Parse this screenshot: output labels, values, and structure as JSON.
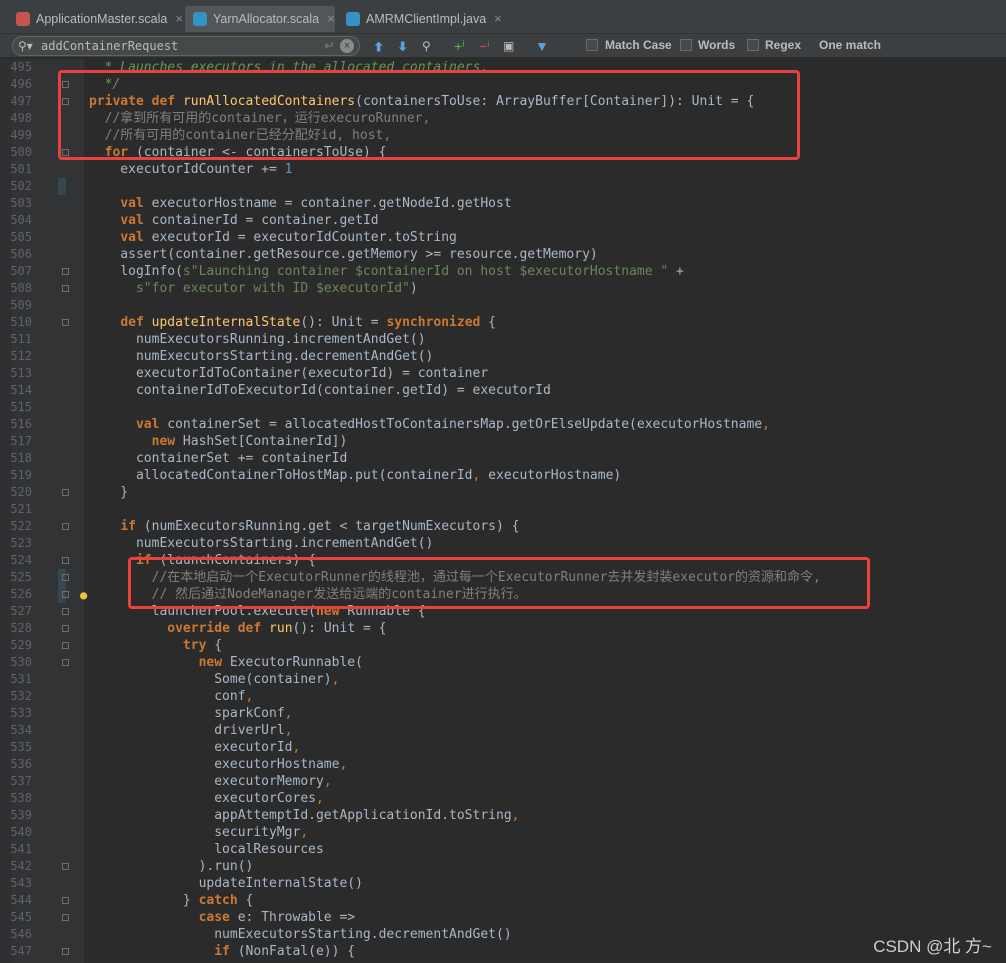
{
  "tabs": [
    {
      "label": "ApplicationMaster.scala",
      "icon": "scala-file-icon",
      "color": "#c75450",
      "active": false
    },
    {
      "label": "YarnAllocator.scala",
      "icon": "scala-class-icon",
      "color": "#3592c4",
      "active": true
    },
    {
      "label": "AMRMClientImpl.java",
      "icon": "java-class-icon",
      "color": "#3592c4",
      "active": false
    }
  ],
  "search": {
    "query": "addContainerRequest",
    "match_case": "Match Case",
    "words": "Words",
    "regex": "Regex",
    "result": "One match"
  },
  "code_lines": [
    {
      "n": "495",
      "t": "  * Launches executors in the allocated containers."
    },
    {
      "n": "496",
      "t": "  */"
    },
    {
      "n": "497",
      "t": "private def runAllocatedContainers(containersToUse: ArrayBuffer[Container]): Unit = {"
    },
    {
      "n": "498",
      "t": "  //拿到所有可用的container，运行execuroRunner,"
    },
    {
      "n": "499",
      "t": "  //所有可用的container已经分配好id, host,"
    },
    {
      "n": "500",
      "t": "  for (container <- containersToUse) {"
    },
    {
      "n": "501",
      "t": "    executorIdCounter += 1"
    },
    {
      "n": "502",
      "t": ""
    },
    {
      "n": "503",
      "t": "    val executorHostname = container.getNodeId.getHost"
    },
    {
      "n": "504",
      "t": "    val containerId = container.getId"
    },
    {
      "n": "505",
      "t": "    val executorId = executorIdCounter.toString"
    },
    {
      "n": "506",
      "t": "    assert(container.getResource.getMemory >= resource.getMemory)"
    },
    {
      "n": "507",
      "t": "    logInfo(s\"Launching container $containerId on host $executorHostname \" +"
    },
    {
      "n": "508",
      "t": "      s\"for executor with ID $executorId\")"
    },
    {
      "n": "509",
      "t": ""
    },
    {
      "n": "510",
      "t": "    def updateInternalState(): Unit = synchronized {"
    },
    {
      "n": "511",
      "t": "      numExecutorsRunning.incrementAndGet()"
    },
    {
      "n": "512",
      "t": "      numExecutorsStarting.decrementAndGet()"
    },
    {
      "n": "513",
      "t": "      executorIdToContainer(executorId) = container"
    },
    {
      "n": "514",
      "t": "      containerIdToExecutorId(container.getId) = executorId"
    },
    {
      "n": "515",
      "t": ""
    },
    {
      "n": "516",
      "t": "      val containerSet = allocatedHostToContainersMap.getOrElseUpdate(executorHostname,"
    },
    {
      "n": "517",
      "t": "        new HashSet[ContainerId])"
    },
    {
      "n": "518",
      "t": "      containerSet += containerId"
    },
    {
      "n": "519",
      "t": "      allocatedContainerToHostMap.put(containerId, executorHostname)"
    },
    {
      "n": "520",
      "t": "    }"
    },
    {
      "n": "521",
      "t": ""
    },
    {
      "n": "522",
      "t": "    if (numExecutorsRunning.get < targetNumExecutors) {"
    },
    {
      "n": "523",
      "t": "      numExecutorsStarting.incrementAndGet()"
    },
    {
      "n": "524",
      "t": "      if (launchContainers) {"
    },
    {
      "n": "525",
      "t": "        //在本地启动一个ExecutorRunner的线程池，通过每一个ExecutorRunner去并发封装executor的资源和命令,"
    },
    {
      "n": "526",
      "t": "        // 然后通过NodeManager发送给远端的container进行执行。"
    },
    {
      "n": "527",
      "t": "        launcherPool.execute(new Runnable {"
    },
    {
      "n": "528",
      "t": "          override def run(): Unit = {"
    },
    {
      "n": "529",
      "t": "            try {"
    },
    {
      "n": "530",
      "t": "              new ExecutorRunnable("
    },
    {
      "n": "531",
      "t": "                Some(container),"
    },
    {
      "n": "532",
      "t": "                conf,"
    },
    {
      "n": "533",
      "t": "                sparkConf,"
    },
    {
      "n": "534",
      "t": "                driverUrl,"
    },
    {
      "n": "535",
      "t": "                executorId,"
    },
    {
      "n": "536",
      "t": "                executorHostname,"
    },
    {
      "n": "537",
      "t": "                executorMemory,"
    },
    {
      "n": "538",
      "t": "                executorCores,"
    },
    {
      "n": "539",
      "t": "                appAttemptId.getApplicationId.toString,"
    },
    {
      "n": "540",
      "t": "                securityMgr,"
    },
    {
      "n": "541",
      "t": "                localResources"
    },
    {
      "n": "542",
      "t": "              ).run()"
    },
    {
      "n": "543",
      "t": "              updateInternalState()"
    },
    {
      "n": "544",
      "t": "            } catch {"
    },
    {
      "n": "545",
      "t": "              case e: Throwable =>"
    },
    {
      "n": "546",
      "t": "                numExecutorsStarting.decrementAndGet()"
    },
    {
      "n": "547",
      "t": "                if (NonFatal(e)) {"
    }
  ],
  "fold_markers": [
    "496",
    "497",
    "500",
    "507",
    "508",
    "510",
    "520",
    "522",
    "524",
    "525",
    "526",
    "527",
    "528",
    "529",
    "530",
    "542",
    "544",
    "545",
    "547"
  ],
  "changed_lines": [
    "502",
    "525",
    "526"
  ],
  "bulb_line": "526",
  "watermark": "CSDN @北 方~",
  "colors": {
    "highlight_box": "#e8423f",
    "keyword": "#cc7832",
    "string": "#6a8759",
    "comment": "#808080",
    "number": "#6897bb"
  }
}
